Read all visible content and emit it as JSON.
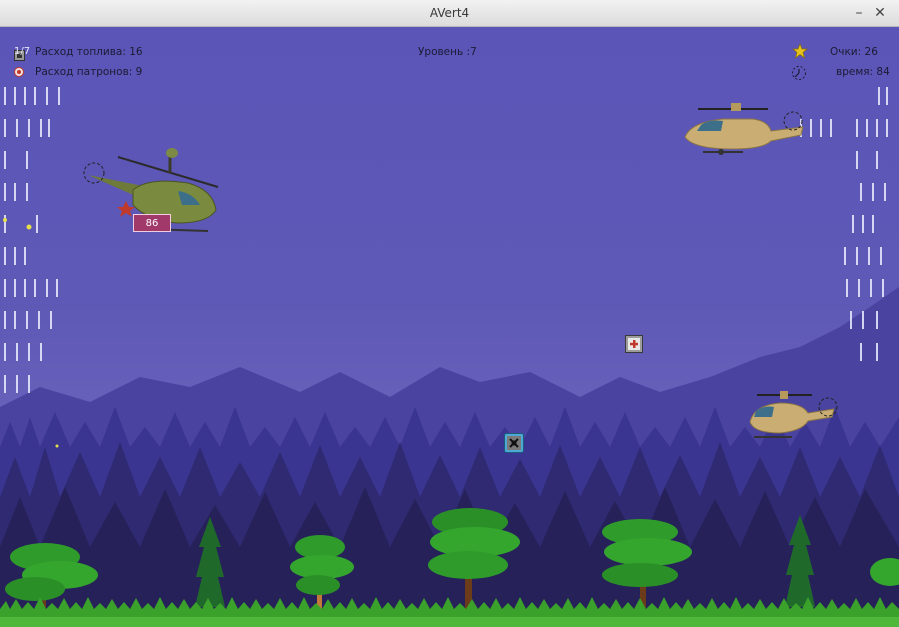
{
  "window": {
    "title": "AVert4",
    "minimize_glyph": "–",
    "close_glyph": "✕"
  },
  "hud": {
    "fuel_label": "Расход топлива: 16",
    "fuel_overlay": "1/7",
    "ammo_label": "Расход патронов: 9",
    "level_label": "Уровень :7",
    "score_label": "Очки: 26",
    "time_label": "время: 84"
  },
  "player": {
    "health": "86",
    "health_color": "#a13a6b"
  },
  "colors": {
    "sky_top": "#5b55b8",
    "mountains": "#4a43a0",
    "forest_far": "#38338a",
    "forest_near": "#2c2866",
    "grass": "#3aa12a",
    "tree_canopy": "#2f9b2a"
  },
  "icons": {
    "fuel": "fuel-canister-icon",
    "ammo": "bullet-target-icon",
    "score": "star-icon",
    "time": "clock-icon"
  }
}
